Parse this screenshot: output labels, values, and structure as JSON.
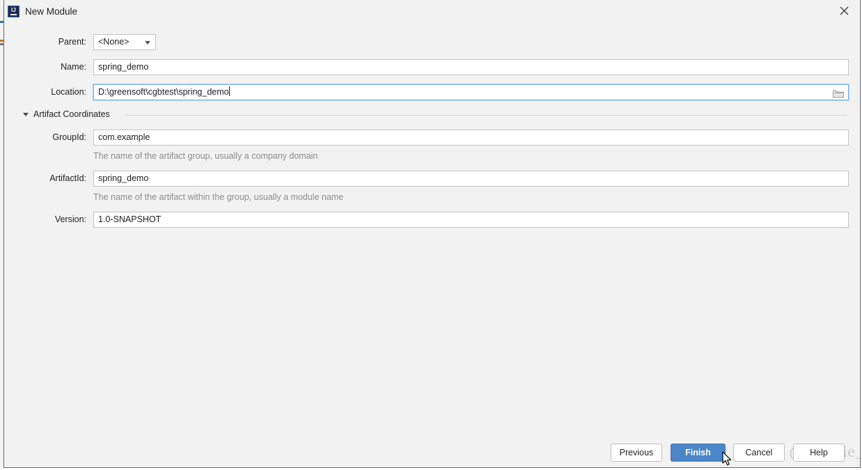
{
  "window": {
    "title": "New Module",
    "app_icon": "intellij-idea-icon",
    "close_icon": "close-icon"
  },
  "form": {
    "parent": {
      "label": "Parent:",
      "value": "<None>",
      "arrow_icon": "chevron-down-icon"
    },
    "name": {
      "label": "Name:",
      "value": "spring_demo"
    },
    "location": {
      "label": "Location:",
      "value": "D:\\greensoft\\cgbtest\\spring_demo",
      "browse_icon": "folder-icon"
    }
  },
  "artifact_section": {
    "title": "Artifact Coordinates",
    "collapse_icon": "triangle-down-icon",
    "group_id": {
      "label": "GroupId:",
      "value": "com.example",
      "hint": "The name of the artifact group, usually a company domain"
    },
    "artifact_id": {
      "label": "ArtifactId:",
      "value": "spring_demo",
      "hint": "The name of the artifact within the group, usually a module name"
    },
    "version": {
      "label": "Version:",
      "value": "1.0-SNAPSHOT"
    }
  },
  "buttons": {
    "previous": "Previous",
    "finish": "Finish",
    "cancel": "Cancel",
    "help": "Help"
  },
  "watermark": "CSDN @Rookie_QYX",
  "colors": {
    "primary_button": "#4a86c8",
    "dialog_background": "#f2f2f2",
    "focus_border": "#7aaee0",
    "hint_text": "#8c8c8c"
  }
}
